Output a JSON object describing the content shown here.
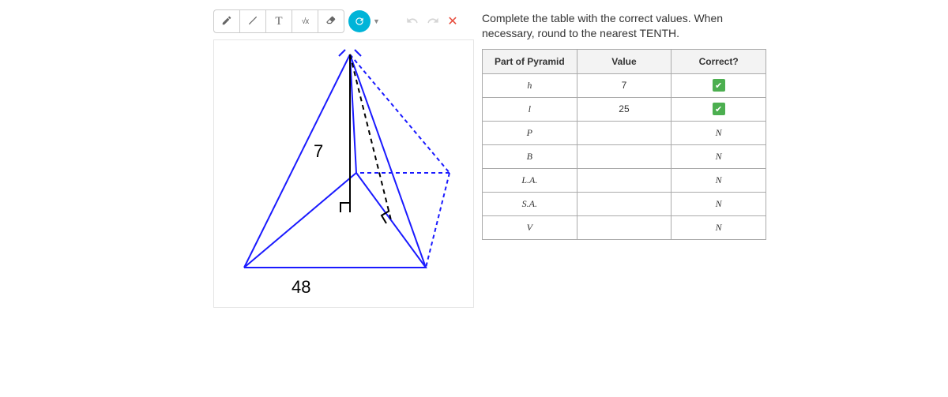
{
  "toolbar": {
    "pen_icon": "pen-icon",
    "line_icon": "line-icon",
    "text_label": "T",
    "sqrt_label": "√x",
    "eraser_icon": "eraser-icon",
    "cycle_icon": "cycle-icon",
    "undo_icon": "undo-icon",
    "redo_icon": "redo-icon",
    "close_icon": "close-icon"
  },
  "diagram": {
    "height_label": "7",
    "base_label": "48"
  },
  "instruction": "Complete the table with the correct values.  When necessary, round to the nearest TENTH.",
  "table": {
    "headers": {
      "part": "Part of Pyramid",
      "value": "Value",
      "correct": "Correct?"
    },
    "rows": [
      {
        "part": "h",
        "value": "7",
        "correct": "check"
      },
      {
        "part": "l",
        "value": "25",
        "correct": "check"
      },
      {
        "part": "P",
        "value": "",
        "correct": "N"
      },
      {
        "part": "B",
        "value": "",
        "correct": "N"
      },
      {
        "part": "L.A.",
        "value": "",
        "correct": "N"
      },
      {
        "part": "S.A.",
        "value": "",
        "correct": "N"
      },
      {
        "part": "V",
        "value": "",
        "correct": "N"
      }
    ]
  }
}
